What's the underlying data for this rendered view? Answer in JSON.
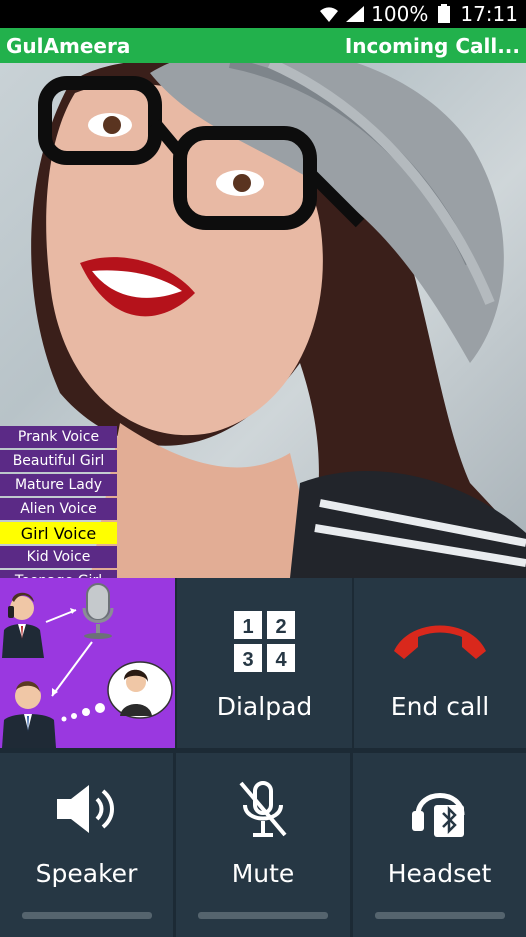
{
  "status_bar": {
    "battery": "100%",
    "time": "17:11",
    "icons": [
      "wifi-icon",
      "signal-icon",
      "battery-icon"
    ]
  },
  "app_bar": {
    "title": "GulAmeera",
    "status": "Incoming Call..."
  },
  "voice_menu": {
    "items": [
      "Prank Voice",
      "Beautiful Girl",
      "Mature Lady",
      "Alien Voice",
      "Girl Voice",
      "Kid Voice",
      "Teenage Girl"
    ],
    "selected": "Girl Voice"
  },
  "controls": {
    "dialpad": {
      "label": "Dialpad",
      "digits": [
        "1",
        "2",
        "3",
        "4"
      ]
    },
    "end_call": {
      "label": "End call"
    },
    "speaker": {
      "label": "Speaker"
    },
    "mute": {
      "label": "Mute"
    },
    "headset": {
      "label": "Headset"
    }
  },
  "colors": {
    "app_bar": "#22b14c",
    "panel": "#263744",
    "voice_menu": "#5b2a86",
    "voice_selected": "#ffff00",
    "end_call": "#d9281c",
    "promo_tile": "#9a38e0"
  }
}
